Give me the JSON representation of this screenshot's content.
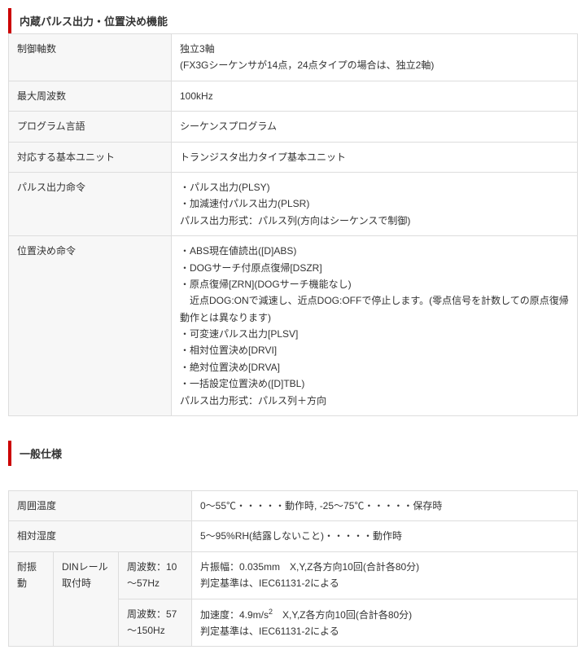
{
  "section1": {
    "title": "内蔵パルス出力・位置決め機能",
    "rows": {
      "axes_label": "制御軸数",
      "axes_value": "独立3軸\n(FX3Gシーケンサが14点，24点タイプの場合は、独立2軸)",
      "freq_label": "最大周波数",
      "freq_value": "100kHz",
      "lang_label": "プログラム言語",
      "lang_value": "シーケンスプログラム",
      "unit_label": "対応する基本ユニット",
      "unit_value": "トランジスタ出力タイプ基本ユニット",
      "pulse_label": "パルス出力命令",
      "pulse_value": "・パルス出力(PLSY)\n・加減速付パルス出力(PLSR)\nパルス出力形式：パルス列(方向はシーケンスで制御)",
      "pos_label": "位置決め命令",
      "pos_value": "・ABS現在値読出([D]ABS)\n・DOGサーチ付原点復帰[DSZR]\n・原点復帰[ZRN](DOGサーチ機能なし)\n　近点DOG:ONで減速し、近点DOG:OFFで停止します。(零点信号を計数しての原点復帰動作とは異なります)\n・可変速パルス出力[PLSV]\n・相対位置決め[DRVI]\n・絶対位置決め[DRVA]\n・一括設定位置決め([D]TBL)\nパルス出力形式：パルス列＋方向"
    }
  },
  "section2": {
    "title": "一般仕様",
    "rows": {
      "temp_label": "周囲温度",
      "temp_value": "0～55℃・・・・・動作時, -25～75℃・・・・・保存時",
      "humid_label": "相対湿度",
      "humid_value": "5～95%RH(結露しないこと)・・・・・動作時",
      "vib_label": "耐振動",
      "vib_sub1": "DINレール取付時",
      "vib_f1_label": "周波数：10～57Hz",
      "vib_f1_value": "片振幅：0.035mm　X,Y,Z各方向10回(合計各80分)\n判定基準は、IEC61131-2による",
      "vib_f2_label": "周波数：57～150Hz",
      "vib_f2_value_pre": "加速度：4.9m/s",
      "vib_f2_value_post": "　X,Y,Z各方向10回(合計各80分)\n判定基準は、IEC61131-2による"
    }
  }
}
